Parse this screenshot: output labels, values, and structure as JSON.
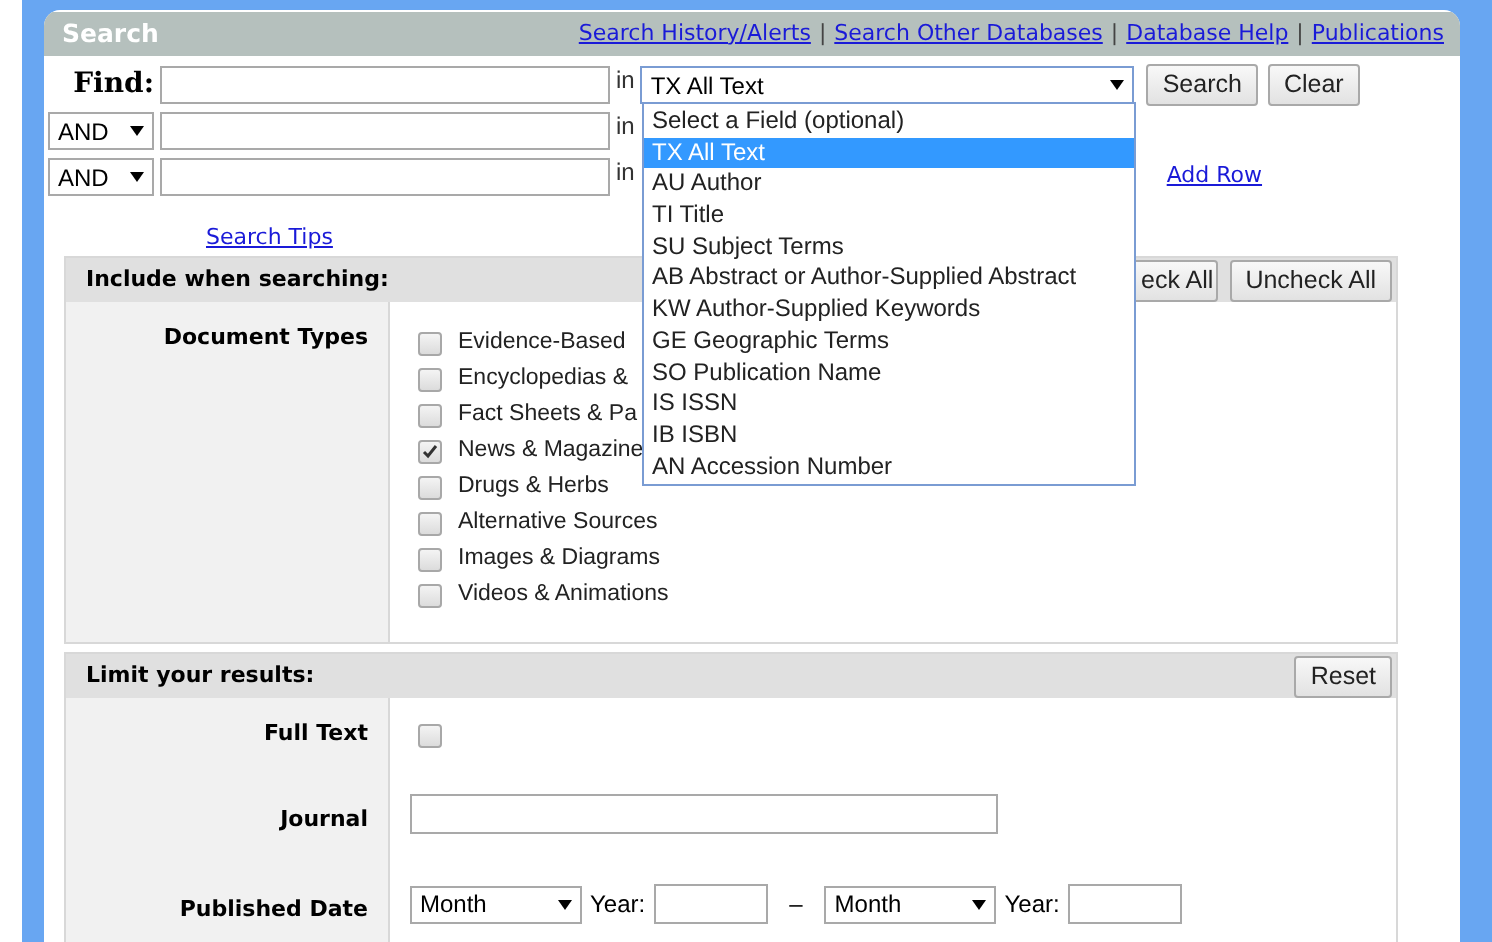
{
  "header": {
    "title": "Search",
    "separator": "|",
    "links": [
      "Search History/Alerts",
      "Search Other Databases",
      "Database Help",
      "Publications"
    ]
  },
  "search_rows": [
    {
      "label": "Find:",
      "in": "in",
      "field": "TX All Text"
    },
    {
      "operator": "AND",
      "in": "in"
    },
    {
      "operator": "AND",
      "in": "in"
    }
  ],
  "search_buttons": [
    "Search",
    "Clear"
  ],
  "add_row": "Add Row",
  "search_tips": "Search Tips",
  "field_dropdown": {
    "expanded": true,
    "options": [
      {
        "label": "Select a Field (optional)",
        "selected": false
      },
      {
        "label": "TX All Text",
        "selected": true
      },
      {
        "label": "AU Author",
        "selected": false
      },
      {
        "label": "TI Title",
        "selected": false
      },
      {
        "label": "SU Subject Terms",
        "selected": false
      },
      {
        "label": "AB Abstract or Author-Supplied Abstract",
        "selected": false
      },
      {
        "label": "KW Author-Supplied Keywords",
        "selected": false
      },
      {
        "label": "GE Geographic Terms",
        "selected": false
      },
      {
        "label": "SO Publication Name",
        "selected": false
      },
      {
        "label": "IS ISSN",
        "selected": false
      },
      {
        "label": "IB ISBN",
        "selected": false
      },
      {
        "label": "AN Accession Number",
        "selected": false
      }
    ]
  },
  "include": {
    "title": "Include when searching:",
    "buttons": [
      "eck All",
      "Uncheck All"
    ],
    "document_types": {
      "label": "Document Types",
      "options": [
        {
          "label": "Evidence-Based",
          "checked": false
        },
        {
          "label": "Encyclopedias &",
          "checked": false
        },
        {
          "label": "Fact Sheets & Pa",
          "checked": false
        },
        {
          "label": "News & Magazine",
          "checked": true
        },
        {
          "label": "Drugs & Herbs",
          "checked": false
        },
        {
          "label": "Alternative Sources",
          "checked": false
        },
        {
          "label": "Images & Diagrams",
          "checked": false
        },
        {
          "label": "Videos & Animations",
          "checked": false
        }
      ]
    }
  },
  "limit": {
    "title": "Limit your results:",
    "reset": "Reset",
    "full_text": {
      "label": "Full Text",
      "checked": false
    },
    "journal": {
      "label": "Journal"
    },
    "published_date": {
      "label": "Published Date",
      "from": {
        "month": "Month",
        "year_label": "Year:"
      },
      "dash": "–",
      "to": {
        "month": "Month",
        "year_label": "Year:"
      }
    }
  }
}
